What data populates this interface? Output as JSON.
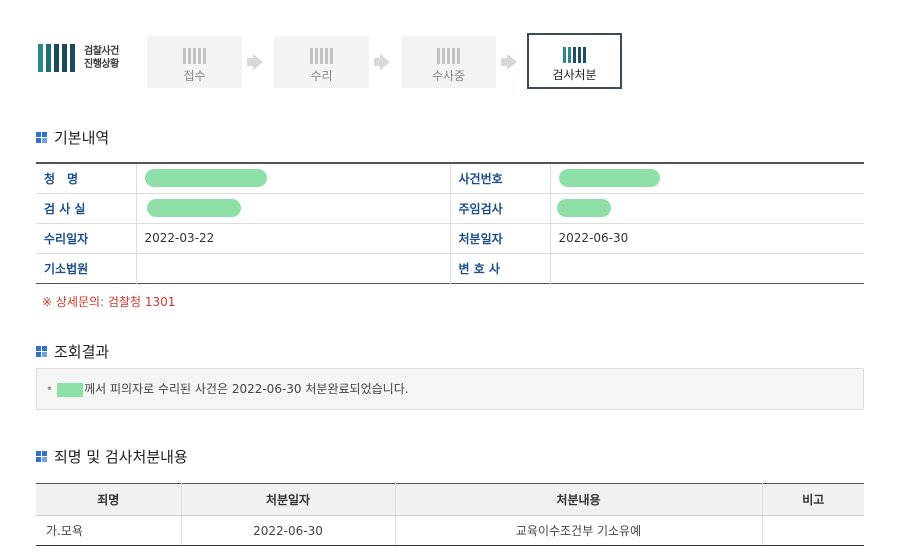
{
  "header": {
    "logo_line1": "검찰사건",
    "logo_line2": "진행상황",
    "steps": [
      {
        "label": "접수",
        "active": false
      },
      {
        "label": "수리",
        "active": false
      },
      {
        "label": "수사중",
        "active": false
      },
      {
        "label": "검사처분",
        "active": true
      }
    ]
  },
  "basic": {
    "title": "기본내역",
    "rows": [
      {
        "k1": "청　명",
        "v1": "",
        "k2": "사건번호",
        "v2": ""
      },
      {
        "k1": "검 사 실",
        "v1": "",
        "k2": "주임검사",
        "v2": ""
      },
      {
        "k1": "수리일자",
        "v1": "2022-03-22",
        "k2": "처분일자",
        "v2": "2022-06-30"
      },
      {
        "k1": "기소법원",
        "v1": "",
        "k2": "변 호 사",
        "v2": ""
      }
    ],
    "note": "※ 상세문의: 검찰청 1301"
  },
  "result": {
    "title": "조회결과",
    "bullet": "•",
    "text": "께서 피의자로 수리된 사건은 2022-06-30 처분완료되었습니다."
  },
  "crime": {
    "title": "죄명 및 검사처분내용",
    "headers": [
      "죄명",
      "처분일자",
      "처분내용",
      "비고"
    ],
    "rows": [
      [
        "가.모욕",
        "2022-06-30",
        "교육이수조건부 기소유예",
        ""
      ]
    ]
  },
  "colors": {
    "accent": "#2f74c9",
    "label": "#1d4f8c",
    "note": "#d0392b",
    "redaction": "#8fe0a8"
  }
}
